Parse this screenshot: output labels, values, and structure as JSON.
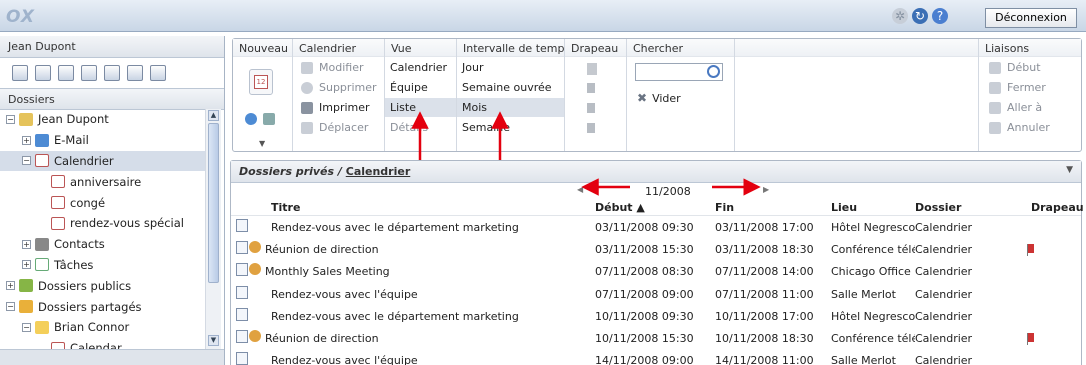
{
  "topbar": {
    "logo": "OX",
    "logout_label": "Déconnexion",
    "icons": [
      "gear-icon",
      "refresh-icon",
      "help-icon"
    ]
  },
  "left": {
    "user_name": "Jean Dupont",
    "folders_label": "Dossiers",
    "module_icons": [
      "home-icon",
      "mail-icon",
      "calendar-icon",
      "contacts-icon",
      "tasks-icon",
      "files-icon",
      "settings-icon"
    ],
    "tree": [
      {
        "label": "Jean Dupont",
        "level": 0,
        "expander": "−",
        "icon": "user"
      },
      {
        "label": "E-Mail",
        "level": 1,
        "expander": "+",
        "icon": "mail"
      },
      {
        "label": "Calendrier",
        "level": 1,
        "expander": "−",
        "icon": "cal",
        "selected": true
      },
      {
        "label": "anniversaire",
        "level": 2,
        "expander": "",
        "icon": "cal"
      },
      {
        "label": "congé",
        "level": 2,
        "expander": "",
        "icon": "cal"
      },
      {
        "label": "rendez-vous spécial",
        "level": 2,
        "expander": "",
        "icon": "cal"
      },
      {
        "label": "Contacts",
        "level": 1,
        "expander": "+",
        "icon": "contacts"
      },
      {
        "label": "Tâches",
        "level": 1,
        "expander": "+",
        "icon": "task"
      },
      {
        "label": "Dossiers publics",
        "level": 0,
        "expander": "+",
        "icon": "pub"
      },
      {
        "label": "Dossiers partagés",
        "level": 0,
        "expander": "−",
        "icon": "share"
      },
      {
        "label": "Brian Connor",
        "level": 1,
        "expander": "−",
        "icon": "folder"
      },
      {
        "label": "Calendar",
        "level": 2,
        "expander": "",
        "icon": "cal"
      }
    ]
  },
  "ribbon": {
    "groups": {
      "nouveau": "Nouveau",
      "calendrier": "Calendrier",
      "vue": "Vue",
      "intervalle": "Intervalle de temps",
      "drapeau": "Drapeau",
      "chercher": "Chercher",
      "liaisons": "Liaisons"
    },
    "calendrier_items": [
      "Modifier",
      "Supprimer",
      "Imprimer",
      "Déplacer"
    ],
    "vue_items": [
      "Calendrier",
      "Équipe",
      "Liste",
      "Détails"
    ],
    "intervalle_items": [
      "Jour",
      "Semaine ouvrée",
      "Mois",
      "Semaine"
    ],
    "chercher_clear": "Vider",
    "liaisons_items": [
      "Début",
      "Fermer",
      "Aller à",
      "Annuler"
    ]
  },
  "main": {
    "breadcrumb_prefix": "Dossiers privés / ",
    "breadcrumb_link": "Calendrier",
    "month": "11/2008",
    "columns": {
      "titre": "Titre",
      "debut": "Début ▲",
      "fin": "Fin",
      "lieu": "Lieu",
      "dossier": "Dossier",
      "drapeau": "Drapeau"
    },
    "rows": [
      {
        "title": "Rendez-vous avec le département marketing",
        "start": "03/11/2008 09:30",
        "end": "03/11/2008 17:00",
        "lieu": "Hôtel Negresco",
        "dossier": "Calendrier",
        "flag": false,
        "series": false
      },
      {
        "title": "Réunion de direction",
        "start": "03/11/2008 15:30",
        "end": "03/11/2008 18:30",
        "lieu": "Conférence télé",
        "dossier": "Calendrier",
        "flag": true,
        "series": true
      },
      {
        "title": "Monthly Sales Meeting",
        "start": "07/11/2008 08:30",
        "end": "07/11/2008 14:00",
        "lieu": "Chicago Office",
        "dossier": "Calendrier",
        "flag": false,
        "series": true
      },
      {
        "title": "Rendez-vous avec l'équipe",
        "start": "07/11/2008 09:00",
        "end": "07/11/2008 11:00",
        "lieu": "Salle Merlot",
        "dossier": "Calendrier",
        "flag": false,
        "series": false
      },
      {
        "title": "Rendez-vous avec le département marketing",
        "start": "10/11/2008 09:30",
        "end": "10/11/2008 17:00",
        "lieu": "Hôtel Negresco",
        "dossier": "Calendrier",
        "flag": false,
        "series": false
      },
      {
        "title": "Réunion de direction",
        "start": "10/11/2008 15:30",
        "end": "10/11/2008 18:30",
        "lieu": "Conférence télé",
        "dossier": "Calendrier",
        "flag": true,
        "series": true
      },
      {
        "title": "Rendez-vous avec l'équipe",
        "start": "14/11/2008 09:00",
        "end": "14/11/2008 11:00",
        "lieu": "Salle Merlot",
        "dossier": "Calendrier",
        "flag": false,
        "series": false
      }
    ]
  }
}
